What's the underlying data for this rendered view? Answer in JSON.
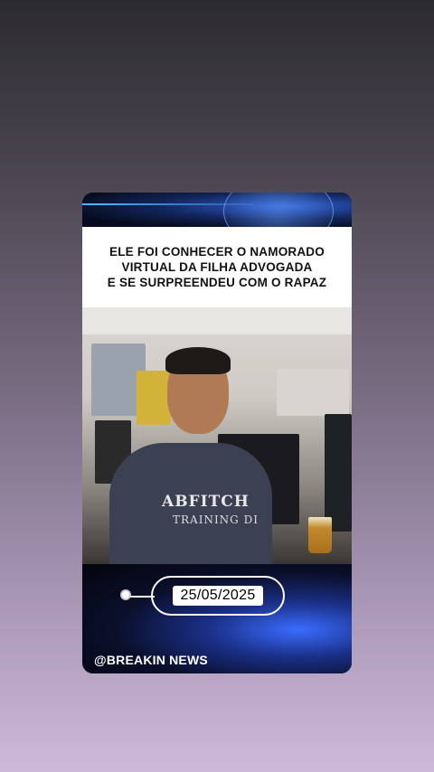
{
  "story": {
    "headline": "ELE FOI CONHECER O NAMORADO\nVIRTUAL DA FILHA ADVOGADA\nE SE SURPREENDEU COM O RAPAZ",
    "date": "25/05/2025",
    "handle": "@BREAKIN NEWS"
  },
  "photo": {
    "shirt_text": "ABFITCH",
    "shirt_sub": "TRAINING DI"
  },
  "colors": {
    "accent": "#2f5fd0",
    "headline_bg": "#ffffff",
    "headline_text": "#111111"
  }
}
